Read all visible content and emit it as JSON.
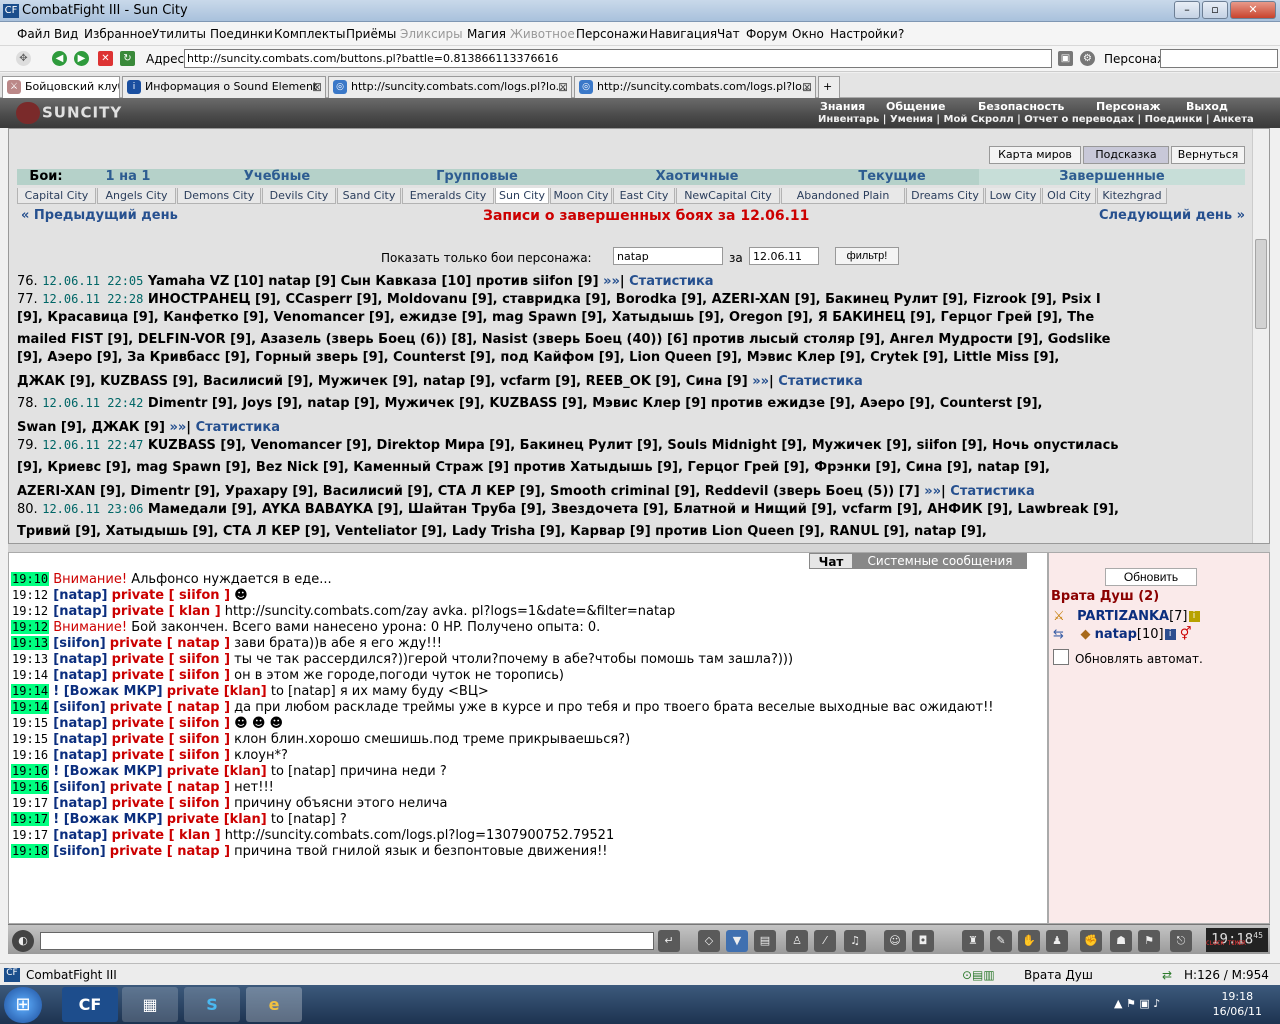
{
  "window": {
    "title": "CombatFight III - Sun City"
  },
  "menu": [
    "Файл",
    "Вид",
    "Избранное",
    "Утилиты",
    "Поединки",
    "Комплекты",
    "Приёмы",
    "Эликсиры",
    "Магия",
    "Животное",
    "Персонажи",
    "Навигация",
    "Чат",
    "Форум",
    "Окно",
    "Настройки",
    "?"
  ],
  "address": {
    "label": "Адрес:",
    "url": "http://suncity.combats.com/buttons.pl?battle=0.813866113376616",
    "persona_label": "Персонаж:"
  },
  "tabs": [
    "Бойцовский клуб",
    "Информация о Sound Element",
    "http://suncity.combats.com/logs.pl?lo...",
    "http://suncity.combats.com/logs.pl?lo..."
  ],
  "game": {
    "logo": "SUNCITY",
    "nav_top": [
      "Знания",
      "Общение",
      "Безопасность",
      "Персонаж",
      "Выход"
    ],
    "nav_bottom": "Инвентарь | Умения | Мой Скролл | Отчет о переводах | Поединки | Анкета"
  },
  "page": {
    "btn_map": "Карта миров",
    "btn_hint": "Подсказка",
    "btn_back": "Вернуться",
    "boi_label": "Бои:",
    "boi_tabs": [
      "1 на 1",
      "Учебные",
      "Групповые",
      "Хаотичные",
      "Текущие",
      "Завершенные"
    ],
    "cities": [
      "Capital City",
      "Angels City",
      "Demons City",
      "Devils City",
      "Sand City",
      "Emeralds City",
      "Sun City",
      "Moon City",
      "East City",
      "NewCapital City",
      "Abandoned Plain",
      "Dreams City",
      "Low City",
      "Old City",
      "Kitezhgrad"
    ],
    "prev_day": "« Предыдущий день",
    "next_day": "Следующий день »",
    "title": "Записи о завершенных боях за 12.06.11",
    "filter_label": "Показать только бои персонажа:",
    "filter_value": "natap",
    "filter_za": "за",
    "filter_date": "12.06.11",
    "filter_btn": "фильтр!",
    "stat": "Статистика",
    "vs": "против",
    "more": "»»"
  },
  "log_lines": [
    {
      "num": "76.",
      "dt": "12.06.11 22:05",
      "text": "Yamaha VZ [10] natap [9] Сын Кавказа [10] против siifon [9]",
      "stat": true
    },
    {
      "num": "77.",
      "dt": "12.06.11 22:28",
      "text": "ИНОСТРАНЕЦ [9], CCasperr [9], Moldovanu [9], ставридка [9], Borodka [9], AZERI-XAN [9], Бакинец Рулит [9], Fizrook [9], Psix I"
    },
    {
      "num": "",
      "dt": "",
      "text": "[9], Красавица [9], Канфетко [9], Venomancer [9], ежидзе [9], mag Spawn [9], Хатыдышь [9], Oregon [9], Я БАКИНЕЦ [9], Герцог Грей [9], The"
    },
    {
      "num": "",
      "dt": "",
      "text": "mailed FIST [9], DELFIN-VOR [9], Азазель (зверь Боец (6)) [8], Nasist (зверь Боец (40)) [6] против лысый столяр [9], Ангел Мудрости [9], Godslike"
    },
    {
      "num": "",
      "dt": "",
      "text": "[9], Аэеро [9], За Кривбасс [9], Горный зверь [9], Counterst [9], под Кайфом [9], Lion Queen [9], Мэвис Клер [9], Crytek [9], Little Miss [9],"
    },
    {
      "num": "",
      "dt": "",
      "text": "ДЖАК [9], KUZBASS [9], Василисий [9], Мужичек [9], natap [9], vcfarm [9], REEB_OK [9], Сина [9]",
      "stat": true
    },
    {
      "num": "78.",
      "dt": "12.06.11 22:42",
      "text": "Dimentr [9], Joys [9], natap [9], Мужичек [9], KUZBASS [9], Мэвис Клер [9] против ежидзе [9], Аэеро [9], Counterst [9],"
    },
    {
      "num": "",
      "dt": "",
      "text": "Swan [9], ДЖАК [9]",
      "stat": true
    },
    {
      "num": "79.",
      "dt": "12.06.11 22:47",
      "text": "KUZBASS [9], Venomancer [9], Direktop Мира [9], Бакинец Рулит [9], Souls Midnight [9], Мужичек [9], siifon [9], Ночь опустилась"
    },
    {
      "num": "",
      "dt": "",
      "text": "[9], Криевс [9], mag Spawn [9], Bez Nick [9], Каменный Страж [9] против Хатыдышь [9], Герцог Грей [9], Фрэнки [9], Сина [9], natap [9],"
    },
    {
      "num": "",
      "dt": "",
      "text": "AZERI-XAN [9], Dimentr [9], Урахару [9], Василисий [9], СТА Л КЕР [9], Smooth criminal [9], Reddevil (зверь Боец (5)) [7]",
      "stat": true
    },
    {
      "num": "80.",
      "dt": "12.06.11 23:06",
      "text": "Мамедали [9], AYKA BABAYKA [9], Шайтан Труба [9], Звездочета [9], Блатной и Нищий [9], vcfarm [9], АНФИК [9], Lawbreak [9],"
    },
    {
      "num": "",
      "dt": "",
      "text": "Тривий [9], Хатыдышь [9], СТА Л КЕР [9], Venteliator [9], Lady Trisha [9], Карвар [9] против Lion Queen [9], RANUL [9], natap [9],"
    }
  ],
  "chat": {
    "tab_chat": "Чат",
    "tab_sys": "Системные сообщения",
    "lines": [
      {
        "t": "19:10",
        "g": true,
        "parts": [
          [
            "wr",
            "Внимание!"
          ],
          [
            "",
            "Альфонсо нуждается в еде..."
          ]
        ]
      },
      {
        "t": "19:12",
        "g": false,
        "parts": [
          [
            "nk",
            "[natap]"
          ],
          [
            "pv",
            "private [ siifon ]"
          ],
          [
            "",
            "☻"
          ]
        ]
      },
      {
        "t": "19:12",
        "g": false,
        "parts": [
          [
            "nk",
            "[natap]"
          ],
          [
            "pv",
            "private [ klan ]"
          ],
          [
            "",
            "http://suncity.combats.com/zay avka. pl?logs=1&date=&filter=natap"
          ]
        ]
      },
      {
        "t": "19:12",
        "g": true,
        "parts": [
          [
            "wr",
            "Внимание!"
          ],
          [
            "",
            "Бой закончен. Всего вами нанесено урона: 0 HP. Получено опыта: 0."
          ]
        ]
      },
      {
        "t": "19:13",
        "g": true,
        "parts": [
          [
            "nk",
            "[siifon]"
          ],
          [
            "pv",
            "private [ natap ]"
          ],
          [
            "",
            "зави брата))в абе я его жду!!!"
          ]
        ]
      },
      {
        "t": "19:13",
        "g": false,
        "parts": [
          [
            "nk",
            "[natap]"
          ],
          [
            "pv",
            "private [ siifon ]"
          ],
          [
            "",
            "ты че так рассердился?))герой чтоли?почему в абе?чтобы помошь там зашла?)))"
          ]
        ]
      },
      {
        "t": "19:14",
        "g": false,
        "parts": [
          [
            "nk",
            "[natap]"
          ],
          [
            "pv",
            "private [ siifon ]"
          ],
          [
            "",
            "он в этом же городе,погоди чуток не торопись)"
          ]
        ]
      },
      {
        "t": "19:14",
        "g": true,
        "parts": [
          [
            "nk",
            "! [Вожак МКР]"
          ],
          [
            "pv",
            "private [klan]"
          ],
          [
            "",
            "to [natap] я их маму буду <ВЦ>"
          ]
        ]
      },
      {
        "t": "19:14",
        "g": true,
        "parts": [
          [
            "nk",
            "[siifon]"
          ],
          [
            "pv",
            "private [ natap ]"
          ],
          [
            "",
            "да при любом раскладе треймы уже в курсе и про тебя и про твоего брата веселые выходные вас ожидают!!"
          ]
        ]
      },
      {
        "t": "19:15",
        "g": false,
        "parts": [
          [
            "nk",
            "[natap]"
          ],
          [
            "pv",
            "private [ siifon ]"
          ],
          [
            "",
            "☻ ☻ ☻"
          ]
        ]
      },
      {
        "t": "19:15",
        "g": false,
        "parts": [
          [
            "nk",
            "[natap]"
          ],
          [
            "pv",
            "private [ siifon ]"
          ],
          [
            "",
            "клон блин.хорошо смешишь.под треме прикрываешься?)"
          ]
        ]
      },
      {
        "t": "19:16",
        "g": false,
        "parts": [
          [
            "nk",
            "[natap]"
          ],
          [
            "pv",
            "private [ siifon ]"
          ],
          [
            "",
            "клоун*?"
          ]
        ]
      },
      {
        "t": "19:16",
        "g": true,
        "parts": [
          [
            "nk",
            "! [Вожак МКР]"
          ],
          [
            "pv",
            "private [klan]"
          ],
          [
            "",
            "to [natap] причина неди ?"
          ]
        ]
      },
      {
        "t": "19:16",
        "g": true,
        "parts": [
          [
            "nk",
            "[siifon]"
          ],
          [
            "pv",
            "private [ natap ]"
          ],
          [
            "",
            "нет!!!"
          ]
        ]
      },
      {
        "t": "19:17",
        "g": false,
        "parts": [
          [
            "nk",
            "[natap]"
          ],
          [
            "pv",
            "private [ siifon ]"
          ],
          [
            "",
            "причину объясни этого нелича"
          ]
        ]
      },
      {
        "t": "19:17",
        "g": true,
        "parts": [
          [
            "nk",
            "! [Вожак МКР]"
          ],
          [
            "pv",
            "private [klan]"
          ],
          [
            "",
            "to [natap] ?"
          ]
        ]
      },
      {
        "t": "19:17",
        "g": false,
        "parts": [
          [
            "nk",
            "[natap]"
          ],
          [
            "pv",
            "private [ klan ]"
          ],
          [
            "",
            "http://suncity.combats.com/logs.pl?log=1307900752.79521"
          ]
        ]
      },
      {
        "t": "19:18",
        "g": true,
        "parts": [
          [
            "nk",
            "[siifon]"
          ],
          [
            "pv",
            "private [ natap ]"
          ],
          [
            "",
            "причина твой гнилой язык и безпонтовые движения!!"
          ]
        ]
      }
    ]
  },
  "side": {
    "refresh": "Обновить",
    "room": "Врата Душ (2)",
    "users": [
      {
        "name": "PARTIZANKA",
        "lvl": "[7]"
      },
      {
        "name": "natap",
        "lvl": "[10]"
      }
    ],
    "auto": "Обновлять автомат."
  },
  "clock": {
    "time": "19:18",
    "sec": "45",
    "label": "CLOCK TIMER"
  },
  "status": {
    "app": "CombatFight III",
    "room": "Врата Душ",
    "hp": "H:126 / M:954"
  },
  "taskbar": {
    "time": "19:18",
    "date": "16/06/11"
  }
}
